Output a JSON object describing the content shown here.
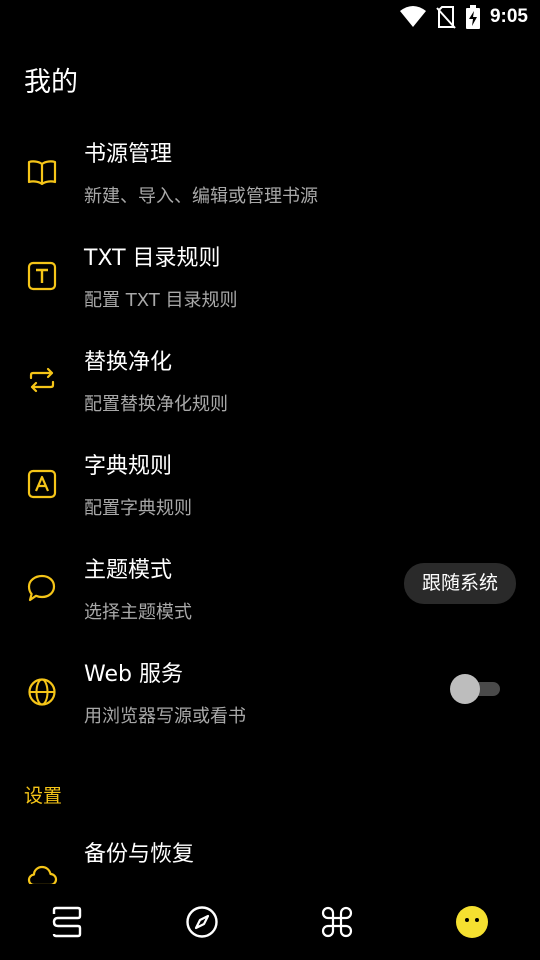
{
  "status_bar": {
    "time": "9:05",
    "icons": [
      "wifi-icon",
      "no-sim-icon",
      "battery-charging-icon"
    ]
  },
  "page_title": "我的",
  "accent_color": "#f5c518",
  "items": [
    {
      "icon": "book-open-icon",
      "title": "书源管理",
      "subtitle": "新建、导入、编辑或管理书源"
    },
    {
      "icon": "text-box-icon",
      "title": "TXT 目录规则",
      "subtitle": "配置 TXT 目录规则"
    },
    {
      "icon": "swap-arrows-icon",
      "title": "替换净化",
      "subtitle": "配置替换净化规则"
    },
    {
      "icon": "letter-box-icon",
      "title": "字典规则",
      "subtitle": "配置字典规则"
    },
    {
      "icon": "chat-bubble-icon",
      "title": "主题模式",
      "subtitle": "选择主题模式",
      "value": "跟随系统"
    },
    {
      "icon": "globe-icon",
      "title": "Web 服务",
      "subtitle": "用浏览器写源或看书",
      "toggle": false
    }
  ],
  "settings_section": {
    "header": "设置",
    "items": [
      {
        "icon": "cloud-icon",
        "title": "备份与恢复"
      }
    ]
  },
  "bottom_nav": [
    {
      "icon": "bookshelf-icon",
      "active": false
    },
    {
      "icon": "compass-icon",
      "active": false
    },
    {
      "icon": "apps-icon",
      "active": false
    },
    {
      "icon": "smiley-icon",
      "active": true
    }
  ]
}
